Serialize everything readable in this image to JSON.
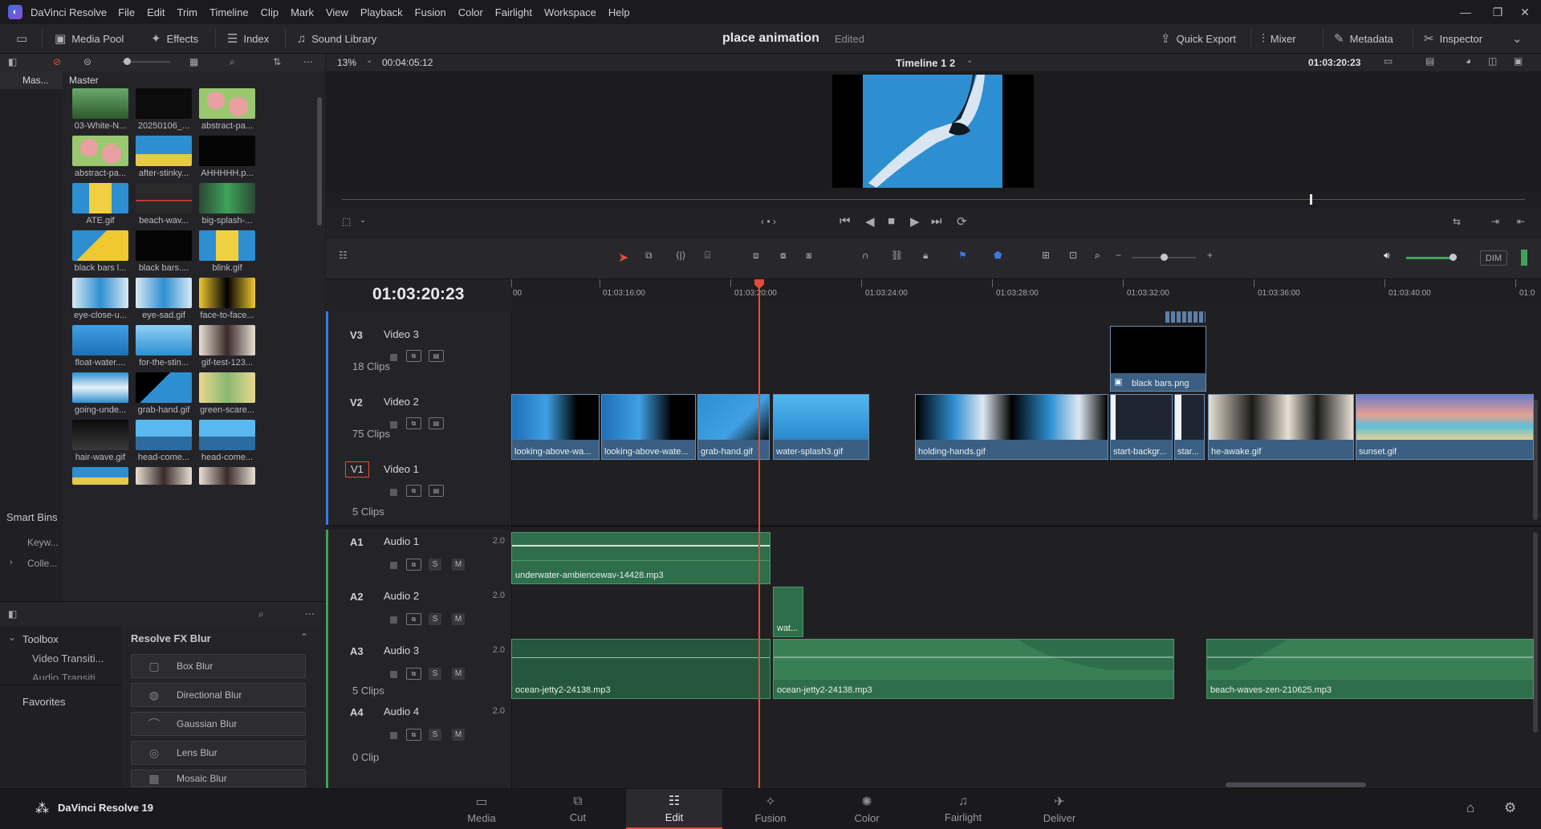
{
  "app": {
    "name": "DaVinci Resolve",
    "footer_name": "DaVinci Resolve 19"
  },
  "menu": [
    "File",
    "Edit",
    "Trim",
    "Timeline",
    "Clip",
    "Mark",
    "View",
    "Playback",
    "Fusion",
    "Color",
    "Fairlight",
    "Workspace",
    "Help"
  ],
  "toolbar": {
    "left": [
      {
        "label": "Media Pool",
        "icon": "media-pool-icon"
      },
      {
        "label": "Effects",
        "icon": "effects-icon"
      },
      {
        "label": "Index",
        "icon": "index-icon"
      },
      {
        "label": "Sound Library",
        "icon": "sound-library-icon"
      }
    ],
    "project_title": "place animation",
    "project_status": "Edited",
    "right": [
      {
        "label": "Quick Export",
        "icon": "quick-export-icon"
      },
      {
        "label": "Mixer",
        "icon": "mixer-icon"
      },
      {
        "label": "Metadata",
        "icon": "metadata-icon"
      },
      {
        "label": "Inspector",
        "icon": "inspector-icon"
      }
    ]
  },
  "viewer_bar": {
    "zoom": "13%",
    "duration": "00:04:05:12",
    "timeline_name": "Timeline 1 2",
    "timecode": "01:03:20:23"
  },
  "media_pool": {
    "bins_header": "Mas...",
    "pool_header": "Master",
    "smart_bins": "Smart Bins",
    "smart_items": [
      "Keyw...",
      "Colle..."
    ],
    "clips": [
      {
        "label": "03-White-N...",
        "style": "white-noise"
      },
      {
        "label": "20250106_...",
        "style": "audio-dark"
      },
      {
        "label": "abstract-pa...",
        "style": "abstract"
      },
      {
        "label": "abstract-pa...",
        "style": "abstract"
      },
      {
        "label": "after-stinky...",
        "style": "figure-blue"
      },
      {
        "label": "AHHHHH.p...",
        "style": "black-img"
      },
      {
        "label": "ATE.gif",
        "style": "yellow-blue"
      },
      {
        "label": "beach-wav...",
        "style": "dark-strip"
      },
      {
        "label": "big-splash-...",
        "style": "green-audio"
      },
      {
        "label": "black bars l...",
        "style": "yellow-blue2"
      },
      {
        "label": "black bars....",
        "style": "black-img"
      },
      {
        "label": "blink.gif",
        "style": "yellow-blue"
      },
      {
        "label": "eye-close-u...",
        "style": "eye"
      },
      {
        "label": "eye-sad.gif",
        "style": "eye"
      },
      {
        "label": "face-to-face...",
        "style": "yellow-figure"
      },
      {
        "label": "float-water....",
        "style": "blue-water"
      },
      {
        "label": "for-the-stin...",
        "style": "blue-light"
      },
      {
        "label": "gif-test-123...",
        "style": "anime"
      },
      {
        "label": "going-unde...",
        "style": "blue-white"
      },
      {
        "label": "grab-hand.gif",
        "style": "blue-hand"
      },
      {
        "label": "green-scare...",
        "style": "anime-yellow"
      },
      {
        "label": "hair-wave.gif",
        "style": "dark-figure"
      },
      {
        "label": "head-come...",
        "style": "sea"
      },
      {
        "label": "head-come...",
        "style": "sea"
      },
      {
        "label": "",
        "style": "figure-blue"
      },
      {
        "label": "",
        "style": "anime"
      },
      {
        "label": "",
        "style": "anime"
      }
    ]
  },
  "toolbox": {
    "tree": [
      "Toolbox",
      "Video Transiti...",
      "Audio Transiti...",
      "Favorites"
    ],
    "fx_header": "Resolve FX Blur",
    "fx_items": [
      "Box Blur",
      "Directional Blur",
      "Gaussian Blur",
      "Lens Blur",
      "Mosaic Blur"
    ]
  },
  "timeline": {
    "timecode": "01:03:20:23",
    "ruler_labels": [
      "00",
      "01:03:16:00",
      "01:03:20:00",
      "01:03:24:00",
      "01:03:28:00",
      "01:03:32:00",
      "01:03:36:00",
      "01:03:40:00",
      "01:0"
    ],
    "tracks": [
      {
        "id": "V3",
        "name": "Video 3",
        "count": "18 Clips"
      },
      {
        "id": "V2",
        "name": "Video 2",
        "count": "75 Clips"
      },
      {
        "id": "V1",
        "name": "Video 1",
        "count": "5 Clips"
      },
      {
        "id": "A1",
        "name": "Audio 1",
        "level": "2.0",
        "count": ""
      },
      {
        "id": "A2",
        "name": "Audio 2",
        "level": "2.0",
        "count": ""
      },
      {
        "id": "A3",
        "name": "Audio 3",
        "level": "2.0",
        "count": "5 Clips"
      },
      {
        "id": "A4",
        "name": "Audio 4",
        "level": "2.0",
        "count": "0 Clip"
      }
    ],
    "v3_clips": [
      {
        "label": "black bars.png"
      }
    ],
    "v2_clips": [
      {
        "label": "looking-above-wa..."
      },
      {
        "label": "looking-above-wate..."
      },
      {
        "label": "grab-hand.gif"
      },
      {
        "label": "water-splash3.gif"
      },
      {
        "label": "holding-hands.gif"
      },
      {
        "label": "start-backgr..."
      },
      {
        "label": "star..."
      },
      {
        "label": "he-awake.gif"
      },
      {
        "label": "sunset.gif"
      }
    ],
    "a1_clips": [
      {
        "label": "underwater-ambiencewav-14428.mp3"
      }
    ],
    "a2_clips": [
      {
        "label": "wat..."
      }
    ],
    "a3_clips": [
      {
        "label": "ocean-jetty2-24138.mp3"
      },
      {
        "label": "ocean-jetty2-24138.mp3"
      },
      {
        "label": "beach-waves-zen-210625.mp3"
      }
    ]
  },
  "pages": [
    {
      "label": "Media",
      "icon": "media-page-icon",
      "active": false
    },
    {
      "label": "Cut",
      "icon": "cut-page-icon",
      "active": false
    },
    {
      "label": "Edit",
      "icon": "edit-page-icon",
      "active": true
    },
    {
      "label": "Fusion",
      "icon": "fusion-page-icon",
      "active": false
    },
    {
      "label": "Color",
      "icon": "color-page-icon",
      "active": false
    },
    {
      "label": "Fairlight",
      "icon": "fairlight-page-icon",
      "active": false
    },
    {
      "label": "Deliver",
      "icon": "deliver-page-icon",
      "active": false
    }
  ],
  "colors": {
    "accent": "#e24c3a",
    "video_clip": "#3a5f82",
    "audio_clip": "#2f6e4a",
    "playhead": "#e24c3a"
  }
}
